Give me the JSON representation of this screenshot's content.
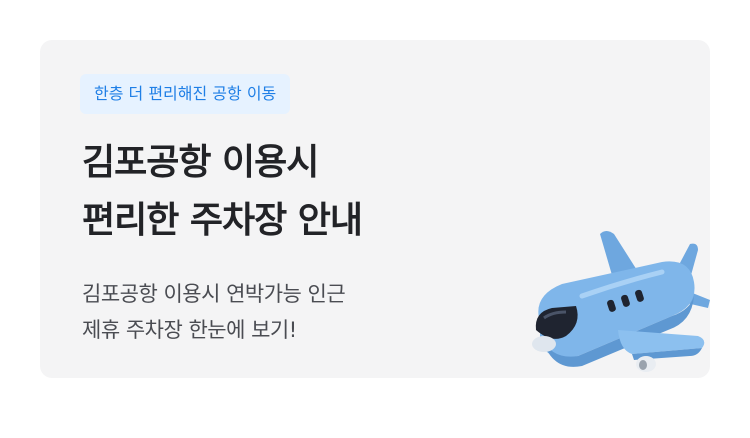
{
  "banner": {
    "badge": "한층 더 편리해진 공항 이동",
    "title_lines": [
      "김포공항 이용시",
      "편리한 주차장 안내"
    ],
    "description_lines": [
      "김포공항 이용시 연박가능 인근",
      "제휴 주차장 한눈에 보기!"
    ],
    "illustration": "airplane-icon",
    "colors": {
      "card_bg": "#f4f4f5",
      "badge_bg": "#e6f2ff",
      "badge_text": "#1f7fe6",
      "title": "#222327",
      "description": "#4a4c52",
      "plane_body": "#7fb6ea"
    }
  }
}
